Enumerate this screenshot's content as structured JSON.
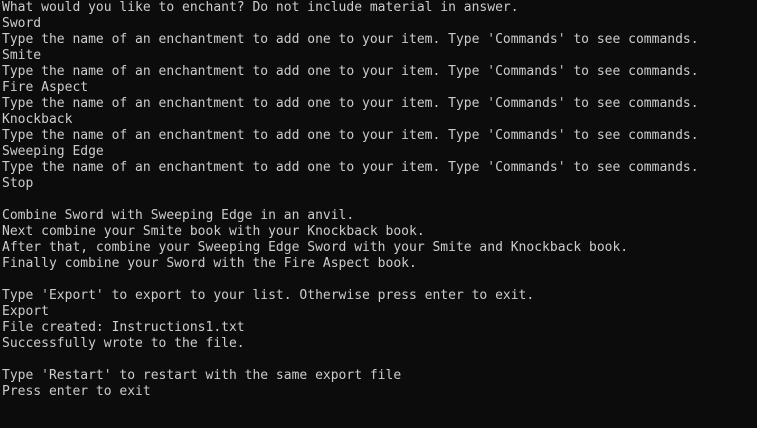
{
  "console": {
    "lines": [
      "What would you like to enchant? Do not include material in answer.",
      "Sword",
      "Type the name of an enchantment to add one to your item. Type 'Commands' to see commands.",
      "Smite",
      "Type the name of an enchantment to add one to your item. Type 'Commands' to see commands.",
      "Fire Aspect",
      "Type the name of an enchantment to add one to your item. Type 'Commands' to see commands.",
      "Knockback",
      "Type the name of an enchantment to add one to your item. Type 'Commands' to see commands.",
      "Sweeping Edge",
      "Type the name of an enchantment to add one to your item. Type 'Commands' to see commands.",
      "Stop",
      "",
      "Combine Sword with Sweeping Edge in an anvil.",
      "Next combine your Smite book with your Knockback book.",
      "After that, combine your Sweeping Edge Sword with your Smite and Knockback book.",
      "Finally combine your Sword with the Fire Aspect book.",
      "",
      "Type 'Export' to export to your list. Otherwise press enter to exit.",
      "Export",
      "File created: Instructions1.txt",
      "Successfully wrote to the file.",
      "",
      "Type 'Restart' to restart with the same export file",
      "Press enter to exit"
    ]
  }
}
